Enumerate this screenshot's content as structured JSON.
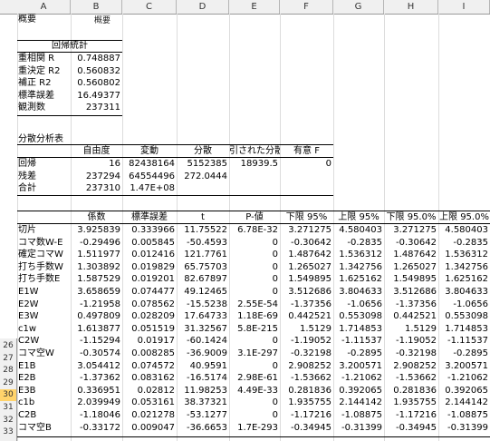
{
  "columns": [
    "A",
    "B",
    "C",
    "D",
    "E",
    "F",
    "G",
    "H",
    "I"
  ],
  "title_fragment": "概要",
  "summary_title": "概要",
  "regression_header": "回帰統計",
  "regression_stats": [
    {
      "label": "重相関 R",
      "value": "0.748887"
    },
    {
      "label": "重決定 R2",
      "value": "0.560832"
    },
    {
      "label": "補正 R2",
      "value": "0.560802"
    },
    {
      "label": "標準誤差",
      "value": "16.49377"
    },
    {
      "label": "観測数",
      "value": "237311"
    }
  ],
  "anova_title": "分散分析表",
  "anova_headers": [
    "",
    "自由度",
    "変動",
    "分散",
    "引された分散",
    "有意 F"
  ],
  "anova_rows": [
    [
      "回帰",
      "16",
      "82438164",
      "5152385",
      "18939.5",
      "0"
    ],
    [
      "残差",
      "237294",
      "64554496",
      "272.0444",
      "",
      ""
    ],
    [
      "合計",
      "237310",
      "1.47E+08",
      "",
      "",
      ""
    ]
  ],
  "coef_headers": [
    "",
    "係数",
    "標準誤差",
    "t",
    "P-値",
    "下限 95%",
    "上限 95%",
    "下限 95.0%",
    "上限 95.0%"
  ],
  "coef_rows": [
    [
      "切片",
      "3.925839",
      "0.333966",
      "11.75522",
      "6.78E-32",
      "3.271275",
      "4.580403",
      "3.271275",
      "4.580403"
    ],
    [
      "コマ数W-E",
      "-0.29496",
      "0.005845",
      "-50.4593",
      "0",
      "-0.30642",
      "-0.2835",
      "-0.30642",
      "-0.2835"
    ],
    [
      "確定コマW",
      "1.511977",
      "0.012416",
      "121.7761",
      "0",
      "1.487642",
      "1.536312",
      "1.487642",
      "1.536312"
    ],
    [
      "打ち手数W",
      "1.303892",
      "0.019829",
      "65.75703",
      "0",
      "1.265027",
      "1.342756",
      "1.265027",
      "1.342756"
    ],
    [
      "打ち手数E",
      "1.587529",
      "0.019201",
      "82.67897",
      "0",
      "1.549895",
      "1.625162",
      "1.549895",
      "1.625162"
    ],
    [
      "E1W",
      "3.658659",
      "0.074477",
      "49.12465",
      "0",
      "3.512686",
      "3.804633",
      "3.512686",
      "3.804633"
    ],
    [
      "E2W",
      "-1.21958",
      "0.078562",
      "-15.5238",
      "2.55E-54",
      "-1.37356",
      "-1.0656",
      "-1.37356",
      "-1.0656"
    ],
    [
      "E3W",
      "0.497809",
      "0.028209",
      "17.64733",
      "1.18E-69",
      "0.442521",
      "0.553098",
      "0.442521",
      "0.553098"
    ],
    [
      "c1w",
      "1.613877",
      "0.051519",
      "31.32567",
      "5.8E-215",
      "1.5129",
      "1.714853",
      "1.5129",
      "1.714853"
    ],
    [
      "C2W",
      "-1.15294",
      "0.01917",
      "-60.1424",
      "0",
      "-1.19052",
      "-1.11537",
      "-1.19052",
      "-1.11537"
    ],
    [
      "コマ空W",
      "-0.30574",
      "0.008285",
      "-36.9009",
      "3.1E-297",
      "-0.32198",
      "-0.2895",
      "-0.32198",
      "-0.2895"
    ],
    [
      "E1B",
      "3.054412",
      "0.074572",
      "40.9591",
      "0",
      "2.908252",
      "3.200571",
      "2.908252",
      "3.200571"
    ],
    [
      "E2B",
      "-1.37362",
      "0.083162",
      "-16.5174",
      "2.98E-61",
      "-1.53662",
      "-1.21062",
      "-1.53662",
      "-1.21062"
    ],
    [
      "E3B",
      "0.336951",
      "0.02812",
      "11.98253",
      "4.49E-33",
      "0.281836",
      "0.392065",
      "0.281836",
      "0.392065"
    ],
    [
      "c1b",
      "2.039949",
      "0.053161",
      "38.37321",
      "0",
      "1.935755",
      "2.144142",
      "1.935755",
      "2.144142"
    ],
    [
      "C2B",
      "-1.18046",
      "0.021278",
      "-53.1277",
      "0",
      "-1.17216",
      "-1.08875",
      "-1.17216",
      "-1.08875"
    ],
    [
      "コマ空B",
      "-0.33172",
      "0.009047",
      "-36.6653",
      "1.7E-293",
      "-0.34945",
      "-0.31399",
      "-0.34945",
      "-0.31399"
    ]
  ],
  "row_numbers": [
    "26",
    "27",
    "28",
    "29",
    "30",
    "31",
    "32",
    "33"
  ],
  "selected_row": "30"
}
